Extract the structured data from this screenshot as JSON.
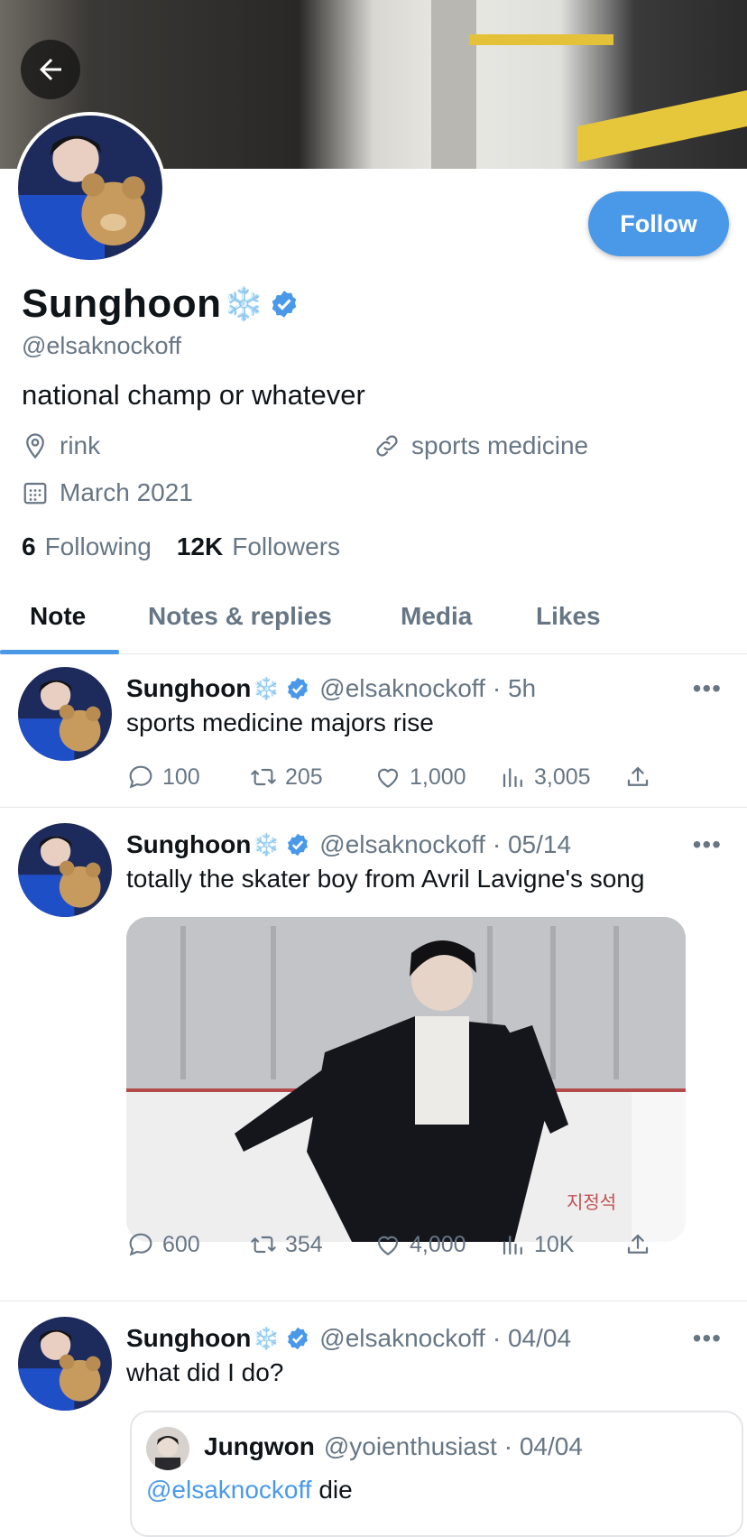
{
  "header": {
    "back_icon": "arrow-left-icon"
  },
  "profile": {
    "name": "Sunghoon",
    "name_emoji": "❄️",
    "handle": "@elsaknockoff",
    "bio": "national champ or whatever",
    "location": "rink",
    "website": "sports medicine",
    "joined": "March 2021",
    "following_count": "6",
    "following_label": "Following",
    "followers_count": "12K",
    "followers_label": "Followers",
    "follow_label": "Follow",
    "verified_color": "#4a99e9"
  },
  "tabs": [
    {
      "label": "Note",
      "active": true
    },
    {
      "label": "Notes & replies",
      "active": false
    },
    {
      "label": "Media",
      "active": false
    },
    {
      "label": "Likes",
      "active": false
    }
  ],
  "posts": [
    {
      "name": "Sunghoon",
      "handle": "@elsaknockoff",
      "time": "· 5h",
      "text": "sports medicine majors rise",
      "replies": "100",
      "renotes": "205",
      "likes": "1,000",
      "views": "3,005"
    },
    {
      "name": "Sunghoon",
      "handle": "@elsaknockoff",
      "time": "· 05/14",
      "text": "totally the skater boy from Avril Lavigne's song",
      "media_sign": "지정석",
      "replies": "600",
      "renotes": "354",
      "likes": "4,000",
      "views": "10K"
    },
    {
      "name": "Sunghoon",
      "handle": "@elsaknockoff",
      "time": "· 04/04",
      "text": "what did I do?",
      "quote": {
        "name": "Jungwon",
        "handle": "@yoienthusiast",
        "time": "· 04/04",
        "mention": "@elsaknockoff",
        "text": "die"
      }
    }
  ],
  "more_label": "•••"
}
